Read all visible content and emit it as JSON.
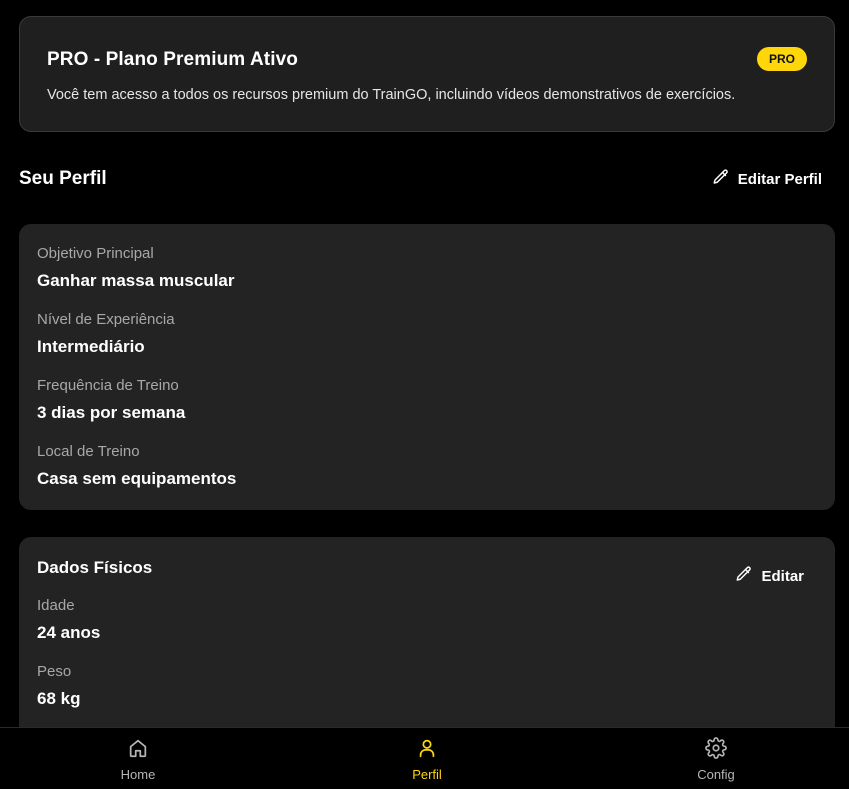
{
  "pro_banner": {
    "title": "PRO - Plano Premium Ativo",
    "badge": "PRO",
    "description": "Você tem acesso a todos os recursos premium do TrainGO, incluindo vídeos demonstrativos de exercícios."
  },
  "profile_section": {
    "title": "Seu Perfil",
    "edit_label": "Editar Perfil"
  },
  "profile": {
    "fields": [
      {
        "label": "Objetivo Principal",
        "value": "Ganhar massa muscular"
      },
      {
        "label": "Nível de Experiência",
        "value": "Intermediário"
      },
      {
        "label": "Frequência de Treino",
        "value": "3 dias por semana"
      },
      {
        "label": "Local de Treino",
        "value": "Casa sem equipamentos"
      }
    ]
  },
  "physical": {
    "title": "Dados Físicos",
    "edit_label": "Editar",
    "fields": [
      {
        "label": "Idade",
        "value": "24 anos"
      },
      {
        "label": "Peso",
        "value": "68 kg"
      }
    ]
  },
  "nav": {
    "items": [
      {
        "label": "Home",
        "icon": "home-icon"
      },
      {
        "label": "Perfil",
        "icon": "user-icon"
      },
      {
        "label": "Config",
        "icon": "gear-icon"
      }
    ],
    "active": "Perfil"
  },
  "colors": {
    "accent": "#ffd60a",
    "background": "#000000",
    "card": "#232323"
  }
}
